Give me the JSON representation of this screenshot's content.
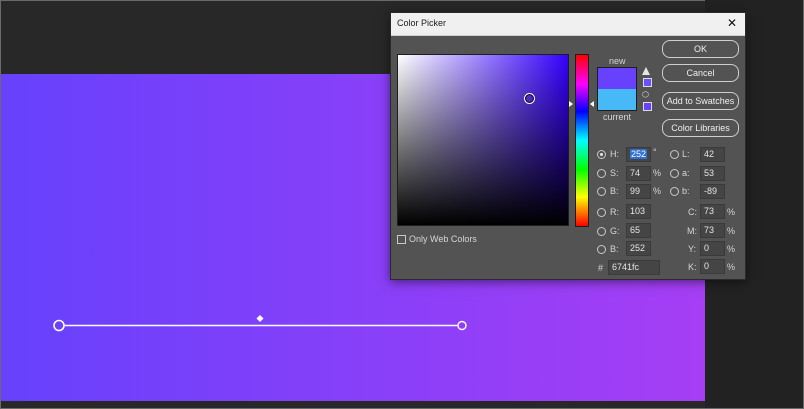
{
  "dialog": {
    "title": "Color Picker",
    "close_glyph": "✕",
    "new_label": "new",
    "current_label": "current",
    "new_color": "#6741fc",
    "current_color": "#48b9f7",
    "only_web_colors_label": "Only Web Colors",
    "buttons": {
      "ok": "OK",
      "cancel": "Cancel",
      "add_to_swatches": "Add to Swatches",
      "color_libraries": "Color Libraries"
    },
    "hsb": {
      "h_label": "H:",
      "h_value": "252",
      "h_unit": "°",
      "s_label": "S:",
      "s_value": "74",
      "s_unit": "%",
      "b_label": "B:",
      "b_value": "99",
      "b_unit": "%"
    },
    "rgb": {
      "r_label": "R:",
      "r_value": "103",
      "g_label": "G:",
      "g_value": "65",
      "b_label": "B:",
      "b_value": "252"
    },
    "lab": {
      "l_label": "L:",
      "l_value": "42",
      "a_label": "a:",
      "a_value": "53",
      "b_label": "b:",
      "b_value": "-89"
    },
    "cmyk": {
      "c_label": "C:",
      "c_value": "73",
      "c_unit": "%",
      "m_label": "M:",
      "m_value": "73",
      "m_unit": "%",
      "y_label": "Y:",
      "y_value": "0",
      "y_unit": "%",
      "k_label": "K:",
      "k_value": "0",
      "k_unit": "%"
    },
    "hex": {
      "label": "#",
      "value": "6741fc"
    }
  },
  "canvas": {
    "gradient_start": "#6741fc",
    "gradient_end": "#a63ef5"
  }
}
